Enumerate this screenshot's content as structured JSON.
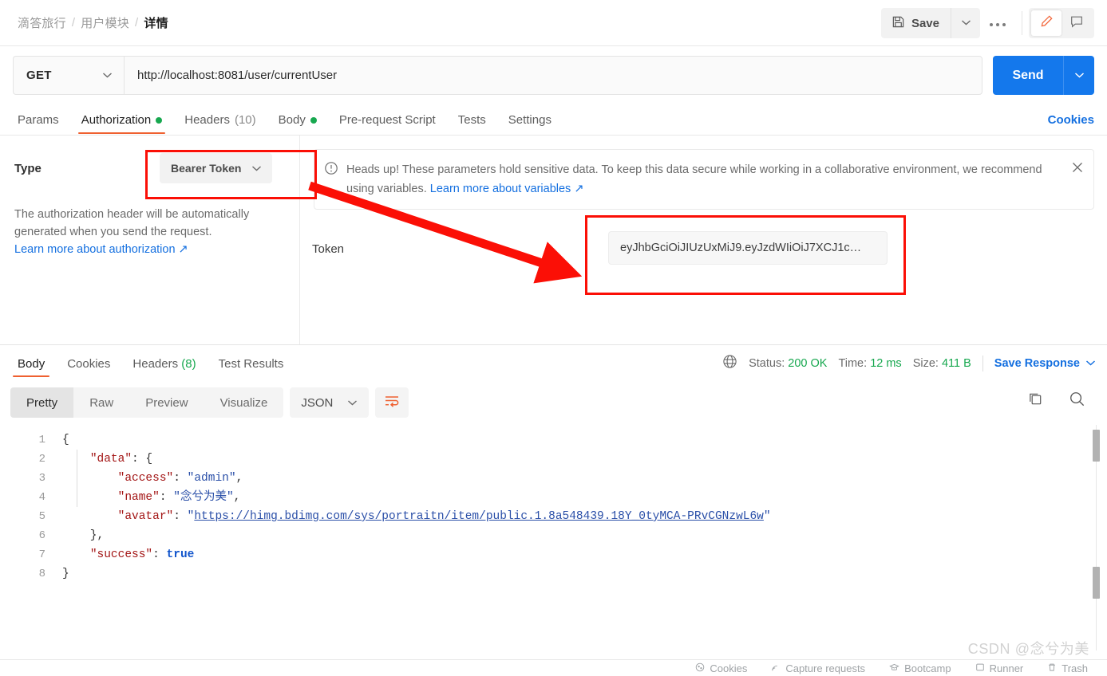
{
  "breadcrumb": {
    "items": [
      {
        "label": "滴答旅行",
        "current": false
      },
      {
        "label": "用户模块",
        "current": false
      },
      {
        "label": "详情",
        "current": true
      }
    ],
    "separator": "/"
  },
  "topbar": {
    "save_label": "Save",
    "save_icon": "floppy-disk-icon",
    "save_caret_icon": "chevron-down-icon",
    "more_icon": "ellipsis-icon",
    "edit_icon": "pencil-icon",
    "comment_icon": "comment-icon",
    "accent_orange": "#ef6030"
  },
  "request": {
    "method": "GET",
    "method_caret_icon": "chevron-down-icon",
    "url": "http://localhost:8081/user/currentUser",
    "send_label": "Send",
    "send_caret_icon": "chevron-down-icon",
    "send_color": "#1478ec"
  },
  "request_tabs": {
    "items": [
      {
        "label": "Params",
        "active": false,
        "dot": false,
        "count": ""
      },
      {
        "label": "Authorization",
        "active": true,
        "dot": true,
        "count": ""
      },
      {
        "label": "Headers",
        "active": false,
        "dot": false,
        "count": "(10)"
      },
      {
        "label": "Body",
        "active": false,
        "dot": true,
        "count": ""
      },
      {
        "label": "Pre-request Script",
        "active": false,
        "dot": false,
        "count": ""
      },
      {
        "label": "Tests",
        "active": false,
        "dot": false,
        "count": ""
      },
      {
        "label": "Settings",
        "active": false,
        "dot": false,
        "count": ""
      }
    ],
    "cookies_link": "Cookies"
  },
  "auth": {
    "type_label": "Type",
    "type_value": "Bearer Token",
    "type_caret_icon": "chevron-down-icon",
    "description": "The authorization header will be automatically generated when you send the request.",
    "learn_more": "Learn more about authorization ↗",
    "heads_up_icon": "alert-circle-icon",
    "heads_up_text": "Heads up! These parameters hold sensitive data. To keep this data secure while working in a collaborative environment, we recommend using variables. ",
    "heads_up_link": "Learn more about variables ↗",
    "heads_up_close_icon": "close-icon",
    "token_label": "Token",
    "token_value": "eyJhbGciOiJIUzUxMiJ9.eyJzdWIiOiJ7XCJ1c…"
  },
  "annotations": {
    "color": "#fb0f06",
    "boxes": [
      "bearer-token-select",
      "token-input"
    ],
    "arrow": "bearer-token-select → token-input"
  },
  "response_tabs": {
    "items": [
      {
        "label": "Body",
        "active": true,
        "count": ""
      },
      {
        "label": "Cookies",
        "active": false,
        "count": ""
      },
      {
        "label": "Headers",
        "active": false,
        "count": "(8)"
      },
      {
        "label": "Test Results",
        "active": false,
        "count": ""
      }
    ]
  },
  "response_meta": {
    "globe_icon": "globe-icon",
    "status_label": "Status:",
    "status_value": "200 OK",
    "time_label": "Time:",
    "time_value": "12 ms",
    "size_label": "Size:",
    "size_value": "411 B",
    "save_response_label": "Save Response",
    "save_response_caret_icon": "chevron-down-icon",
    "green": "#17a84f"
  },
  "viewer": {
    "modes": [
      {
        "label": "Pretty",
        "active": true
      },
      {
        "label": "Raw",
        "active": false
      },
      {
        "label": "Preview",
        "active": false
      },
      {
        "label": "Visualize",
        "active": false
      }
    ],
    "format": "JSON",
    "format_caret_icon": "chevron-down-icon",
    "wrap_icon": "word-wrap-icon",
    "copy_icon": "copy-icon",
    "search_icon": "search-icon"
  },
  "code": {
    "line_numbers": [
      "1",
      "2",
      "3",
      "4",
      "5",
      "6",
      "7",
      "8"
    ],
    "lines": [
      [
        {
          "t": "{",
          "c": "punct"
        }
      ],
      [
        {
          "t": "    ",
          "c": "punct"
        },
        {
          "t": "\"data\"",
          "c": "key"
        },
        {
          "t": ": {",
          "c": "punct"
        }
      ],
      [
        {
          "t": "        ",
          "c": "punct"
        },
        {
          "t": "\"access\"",
          "c": "key"
        },
        {
          "t": ": ",
          "c": "punct"
        },
        {
          "t": "\"admin\"",
          "c": "str"
        },
        {
          "t": ",",
          "c": "punct"
        }
      ],
      [
        {
          "t": "        ",
          "c": "punct"
        },
        {
          "t": "\"name\"",
          "c": "key"
        },
        {
          "t": ": ",
          "c": "punct"
        },
        {
          "t": "\"念兮为美\"",
          "c": "str"
        },
        {
          "t": ",",
          "c": "punct"
        }
      ],
      [
        {
          "t": "        ",
          "c": "punct"
        },
        {
          "t": "\"avatar\"",
          "c": "key"
        },
        {
          "t": ": ",
          "c": "punct"
        },
        {
          "t": "\"",
          "c": "str"
        },
        {
          "t": "https://himg.bdimg.com/sys/portraitn/item/public.1.8a548439.18Y_0tyMCA-PRvCGNzwL6w",
          "c": "link"
        },
        {
          "t": "\"",
          "c": "str"
        }
      ],
      [
        {
          "t": "    },",
          "c": "punct"
        }
      ],
      [
        {
          "t": "    ",
          "c": "punct"
        },
        {
          "t": "\"success\"",
          "c": "key"
        },
        {
          "t": ": ",
          "c": "punct"
        },
        {
          "t": "true",
          "c": "bool"
        }
      ],
      [
        {
          "t": "}",
          "c": "punct"
        }
      ]
    ]
  },
  "footer": {
    "items": [
      {
        "label": "Cookies",
        "icon": "cookie-icon"
      },
      {
        "label": "Capture requests",
        "icon": "satellite-icon"
      },
      {
        "label": "Bootcamp",
        "icon": "graduation-icon"
      },
      {
        "label": "Runner",
        "icon": "runner-icon"
      },
      {
        "label": "Trash",
        "icon": "trash-icon"
      }
    ]
  },
  "watermark": "CSDN @念兮为美"
}
